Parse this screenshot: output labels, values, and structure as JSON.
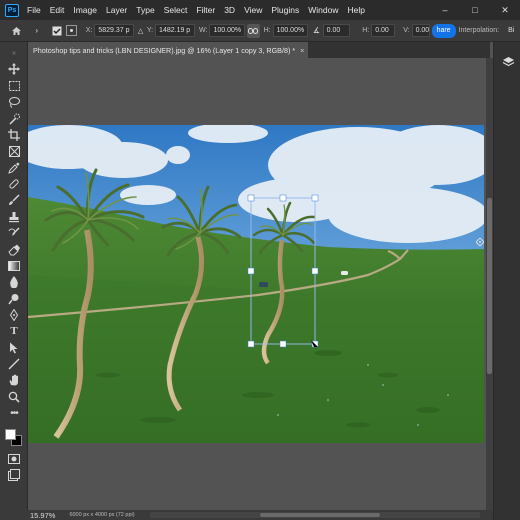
{
  "app": {
    "logo": "Ps",
    "menu": [
      "File",
      "Edit",
      "Image",
      "Layer",
      "Type",
      "Select",
      "Filter",
      "3D",
      "View",
      "Plugins",
      "Window",
      "Help"
    ],
    "window_controls": [
      "–",
      "□",
      "✕"
    ]
  },
  "options": {
    "x_label": "X:",
    "x_value": "5829.37 p",
    "y_label": "Y:",
    "y_value": "1482.19 p",
    "w_label": "W:",
    "w_value": "100.00%",
    "h_label": "H:",
    "h_value": "100.00%",
    "angle_value": "0.00",
    "hskew_label": "H:",
    "hskew_value": "0.00",
    "vskew_label": "V:",
    "vskew_value": "0.00",
    "commit_label": "hare",
    "interpolation_label": "Interpolation:",
    "interpolation_value": "Bi"
  },
  "document": {
    "tab_title": "Photoshop tips and tricks (LBN DESIGNER).jpg @ 16% (Layer 1 copy 3, RGB/8) *",
    "close": "×"
  },
  "tools": [
    "move-icon",
    "marquee-icon",
    "lasso-icon",
    "quick-select-icon",
    "crop-icon",
    "frame-icon",
    "eyedropper-icon",
    "healing-brush-icon",
    "brush-icon",
    "clone-stamp-icon",
    "history-brush-icon",
    "eraser-icon",
    "gradient-icon",
    "blur-icon",
    "dodge-icon",
    "pen-icon",
    "type-icon",
    "path-select-icon",
    "line-icon",
    "hand-icon",
    "zoom-icon",
    "more-tools-icon"
  ],
  "status": {
    "zoom": "15.97%",
    "doc_info": "6000 px x 4000 px (72 ppi)"
  },
  "colors": {
    "menubar": "#2b2b2b",
    "optbar": "#3a3a3a",
    "workspace": "#535353",
    "accent": "#1473e6",
    "sky": "#4a8fd0",
    "grass": "#3f7a2c"
  }
}
